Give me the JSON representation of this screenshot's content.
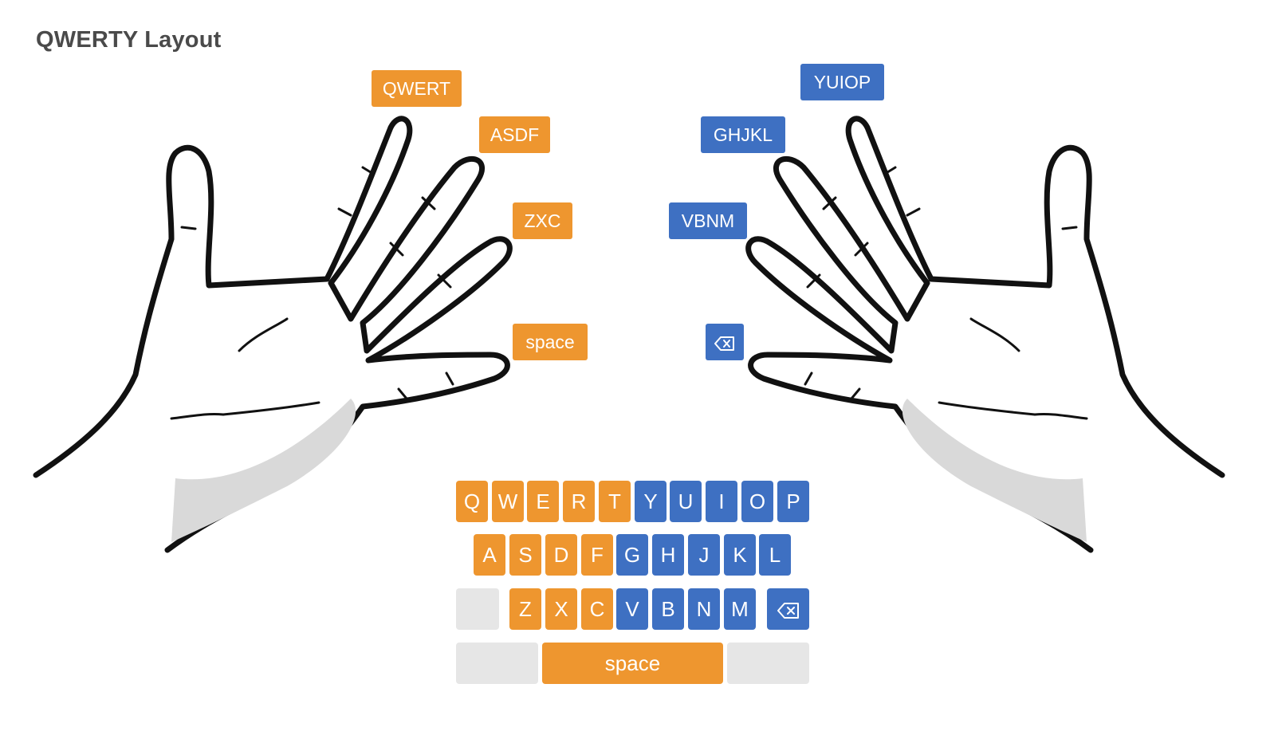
{
  "title": "QWERTY Layout",
  "colors": {
    "left_hand": "#ee962f",
    "right_hand": "#3e70c2",
    "unused_key": "#e6e6e6"
  },
  "finger_labels": {
    "left": [
      "QWERT",
      "ASDF",
      "ZXC",
      "space"
    ],
    "right": [
      "YUIOP",
      "GHJKL",
      "VBNM",
      "backspace-icon"
    ]
  },
  "keyboard": {
    "row1": [
      "Q",
      "W",
      "E",
      "R",
      "T",
      "Y",
      "U",
      "I",
      "O",
      "P"
    ],
    "row2": [
      "A",
      "S",
      "D",
      "F",
      "G",
      "H",
      "J",
      "K",
      "L"
    ],
    "row3": [
      "Z",
      "X",
      "C",
      "V",
      "B",
      "N",
      "M"
    ],
    "space_label": "space"
  }
}
